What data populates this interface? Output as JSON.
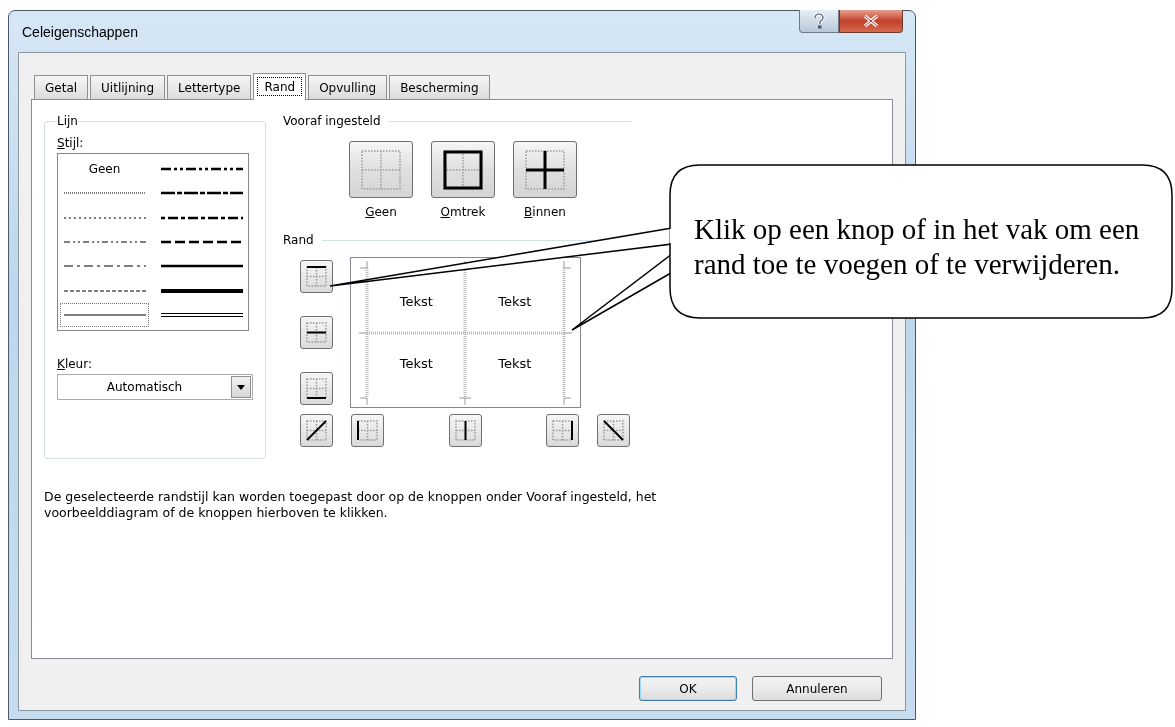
{
  "window": {
    "title": "Celeigenschappen"
  },
  "tabs": [
    {
      "label": "Getal",
      "selected": false
    },
    {
      "label": "Uitlijning",
      "selected": false
    },
    {
      "label": "Lettertype",
      "selected": false
    },
    {
      "label": "Rand",
      "selected": true
    },
    {
      "label": "Opvulling",
      "selected": false
    },
    {
      "label": "Bescherming",
      "selected": false
    }
  ],
  "line_group": {
    "title": "Lijn",
    "style_label": "Stijl:",
    "styles": [
      {
        "kind": "none",
        "label": "Geen",
        "selected": false
      },
      {
        "kind": "hair",
        "selected": false
      },
      {
        "kind": "dotted",
        "selected": false
      },
      {
        "kind": "dashdotdot",
        "selected": false
      },
      {
        "kind": "dashdot",
        "selected": false
      },
      {
        "kind": "dashed",
        "selected": false
      },
      {
        "kind": "thin",
        "selected": true
      },
      {
        "kind": "medium-dashdotdot",
        "selected": false
      },
      {
        "kind": "slant-dashdot",
        "selected": false
      },
      {
        "kind": "medium-dashdot",
        "selected": false
      },
      {
        "kind": "medium-dashed",
        "selected": false
      },
      {
        "kind": "medium",
        "selected": false
      },
      {
        "kind": "thick",
        "selected": false
      },
      {
        "kind": "double",
        "selected": false
      }
    ],
    "color_label": "Kleur:",
    "color_value": "Automatisch"
  },
  "presets": {
    "title": "Vooraf ingesteld",
    "buttons": [
      {
        "kind": "none",
        "label": "Geen"
      },
      {
        "kind": "outline",
        "label": "Omtrek"
      },
      {
        "kind": "inside",
        "label": "Binnen"
      }
    ]
  },
  "border": {
    "title": "Rand",
    "side_buttons": [
      {
        "kind": "top"
      },
      {
        "kind": "middle-h"
      },
      {
        "kind": "bottom"
      }
    ],
    "bottom_buttons": [
      {
        "kind": "diag-up"
      },
      {
        "kind": "left"
      },
      {
        "kind": "middle-v"
      },
      {
        "kind": "right"
      },
      {
        "kind": "diag-down"
      }
    ],
    "preview_cells": [
      "Tekst",
      "Tekst",
      "Tekst",
      "Tekst"
    ]
  },
  "description": "De geselecteerde randstijl kan worden toegepast door op de knoppen onder Vooraf ingesteld, het voorbeelddiagram of de knoppen hierboven te klikken.",
  "buttons": [
    {
      "label": "OK",
      "default": true
    },
    {
      "label": "Annuleren",
      "default": false
    }
  ],
  "callout": {
    "text": "Klik op een knop of in het vak om een rand toe te voegen of te verwijderen."
  }
}
